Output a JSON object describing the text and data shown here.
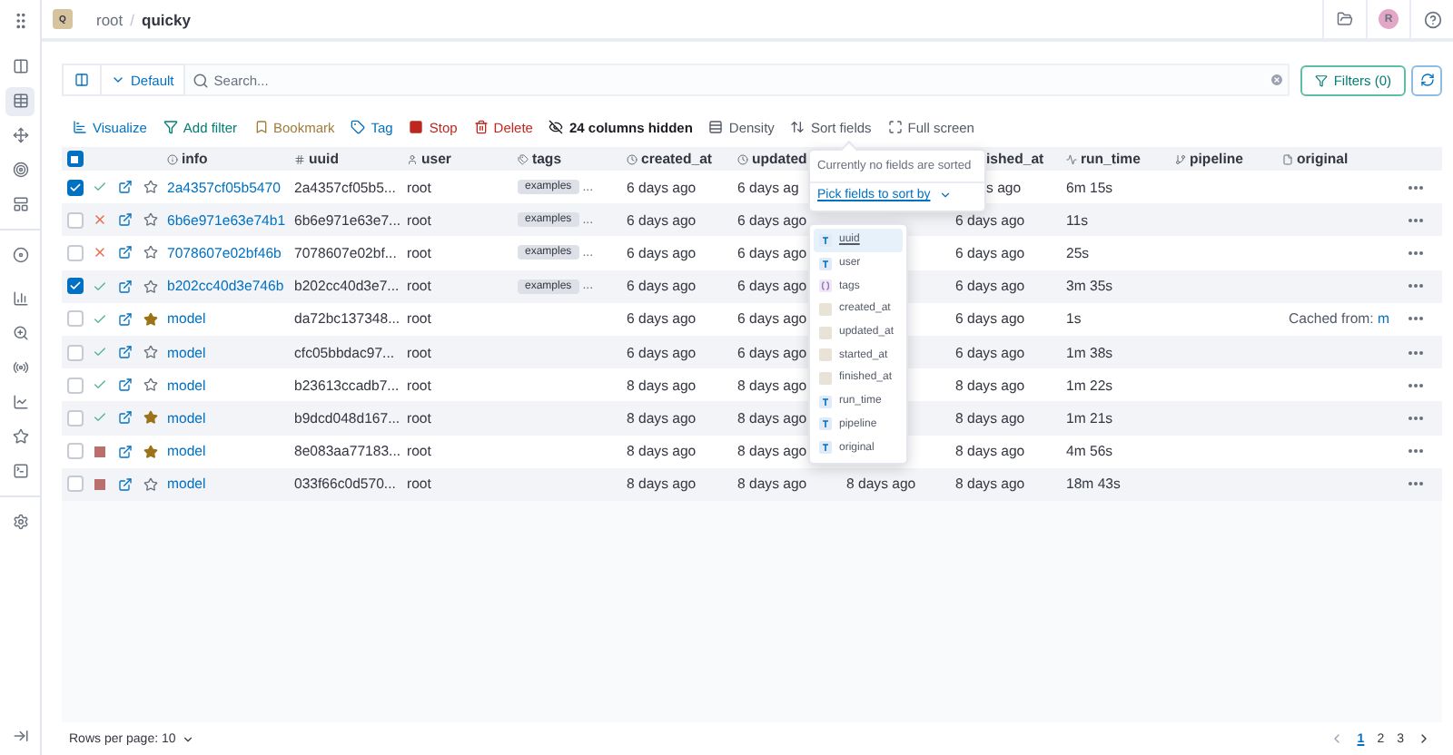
{
  "app": {
    "logo": "Q",
    "breadcrumb": [
      "root",
      "quicky"
    ],
    "separator": "/",
    "avatar": "R"
  },
  "sidebar": {
    "items": [
      {
        "selected": false
      },
      {
        "selected": true
      },
      {
        "selected": false
      },
      {
        "selected": false
      },
      {
        "selected": false
      },
      {
        "selected": false
      },
      {
        "selected": false
      },
      {
        "selected": false
      },
      {
        "selected": false
      },
      {
        "selected": false
      },
      {
        "selected": false
      },
      {
        "selected": false
      },
      {
        "selected": false
      }
    ]
  },
  "search": {
    "view": "Default",
    "placeholder": "Search...",
    "filters": "Filters (0)"
  },
  "toolbar": [
    {
      "kind": "visualize",
      "label": "Visualize"
    },
    {
      "kind": "filter",
      "label": "Add filter"
    },
    {
      "kind": "bookmark",
      "label": "Bookmark"
    },
    {
      "kind": "tag",
      "label": "Tag"
    },
    {
      "kind": "stop",
      "label": "Stop"
    },
    {
      "kind": "delete",
      "label": "Delete"
    },
    {
      "kind": "hidden",
      "label": "24 columns hidden"
    },
    {
      "kind": "density",
      "label": "Density"
    },
    {
      "kind": "sort",
      "label": "Sort fields"
    },
    {
      "kind": "fullscreen",
      "label": "Full screen"
    }
  ],
  "table": {
    "select_all_partial": true,
    "columns": [
      {
        "label": "info"
      },
      {
        "label": "uuid"
      },
      {
        "label": "user"
      },
      {
        "label": "tags"
      },
      {
        "label": "created_at"
      },
      {
        "label": "updated"
      },
      {},
      {
        "label": "ished_at"
      },
      {
        "label": "run_time"
      },
      {
        "label": "pipeline"
      },
      {
        "label": "original"
      }
    ],
    "rows": [
      {
        "selected": true,
        "kind": "ok",
        "starred": false,
        "cells": [
          "2a4357cf05b5470",
          "2a4357cf05b5...",
          "root",
          {
            "tag": "examples",
            "more": "..."
          },
          "6 days ago",
          "6 days ag",
          null,
          "s ago",
          "6m 15s",
          null,
          null
        ]
      },
      {
        "selected": false,
        "kind": "failed",
        "starred": false,
        "cells": [
          "6b6e971e63e74b1",
          "6b6e971e63e7...",
          "root",
          {
            "tag": "examples",
            "more": "..."
          },
          "6 days ago",
          "6 days ago",
          null,
          "6 days ago",
          "11s",
          null,
          null
        ]
      },
      {
        "selected": false,
        "kind": "failed",
        "starred": false,
        "cells": [
          "7078607e02bf46b",
          "7078607e02bf...",
          "root",
          {
            "tag": "examples",
            "more": "..."
          },
          "6 days ago",
          "6 days ago",
          null,
          "6 days ago",
          "25s",
          null,
          null
        ]
      },
      {
        "selected": true,
        "kind": "ok",
        "starred": false,
        "cells": [
          "b202cc40d3e746b",
          "b202cc40d3e7...",
          "root",
          {
            "tag": "examples",
            "more": "..."
          },
          "6 days ago",
          "6 days ago",
          null,
          "6 days ago",
          "3m 35s",
          null,
          null
        ]
      },
      {
        "selected": false,
        "kind": "ok",
        "starred": true,
        "cells": [
          "model",
          "da72bc137348...",
          "root",
          null,
          "6 days ago",
          "6 days ago",
          null,
          "6 days ago",
          "1s",
          null,
          {
            "text": "Cached from:",
            "link": "m"
          }
        ]
      },
      {
        "selected": false,
        "kind": "ok",
        "starred": false,
        "cells": [
          "model",
          "cfc05bbdac97...",
          "root",
          null,
          "6 days ago",
          "6 days ago",
          null,
          "6 days ago",
          "1m 38s",
          null,
          null
        ]
      },
      {
        "selected": false,
        "kind": "ok",
        "starred": false,
        "cells": [
          "model",
          "b23613ccadb7...",
          "root",
          null,
          "8 days ago",
          "8 days ago",
          null,
          "8 days ago",
          "1m 22s",
          null,
          null
        ]
      },
      {
        "selected": false,
        "kind": "ok",
        "starred": true,
        "cells": [
          "model",
          "b9dcd048d167...",
          "root",
          null,
          "8 days ago",
          "8 days ago",
          null,
          "8 days ago",
          "1m 21s",
          null,
          null
        ]
      },
      {
        "selected": false,
        "kind": "stopped",
        "starred": true,
        "cells": [
          "model",
          "8e083aa77183...",
          "root",
          null,
          "8 days ago",
          "8 days ago",
          null,
          "8 days ago",
          "4m 56s",
          null,
          null
        ]
      },
      {
        "selected": false,
        "kind": "stopped",
        "starred": false,
        "cells": [
          "model",
          "033f66c0d570...",
          "root",
          null,
          "8 days ago",
          "8 days ago",
          "8 days ago",
          "8 days ago",
          "18m 43s",
          null,
          null
        ]
      }
    ]
  },
  "sort_popover": {
    "message": "Currently no fields are sorted",
    "link": "Pick fields to sort by",
    "fields": [
      {
        "label": "uuid",
        "kind": "text",
        "selected": true
      },
      {
        "label": "user",
        "kind": "text",
        "selected": false
      },
      {
        "label": "tags",
        "kind": "array",
        "selected": false
      },
      {
        "label": "created_at",
        "kind": "date",
        "selected": false
      },
      {
        "label": "updated_at",
        "kind": "date",
        "selected": false
      },
      {
        "label": "started_at",
        "kind": "date",
        "selected": false
      },
      {
        "label": "finished_at",
        "kind": "date",
        "selected": false
      },
      {
        "label": "run_time",
        "kind": "text",
        "selected": false
      },
      {
        "label": "pipeline",
        "kind": "text",
        "selected": false
      },
      {
        "label": "original",
        "kind": "text",
        "selected": false
      }
    ]
  },
  "footer": {
    "rows_per_page": "Rows per page: 10",
    "pages": [
      {
        "label": "1",
        "selected": true
      },
      {
        "label": "2",
        "selected": false
      },
      {
        "label": "3",
        "selected": false
      }
    ]
  }
}
